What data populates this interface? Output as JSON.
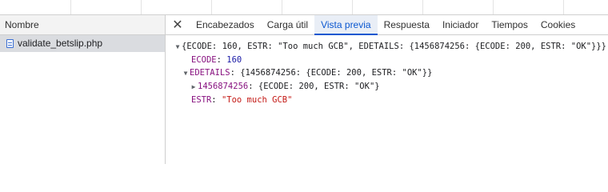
{
  "left_panel": {
    "header": "Nombre",
    "file": "validate_betslip.php"
  },
  "tabs": {
    "close_symbol": "✕",
    "items": [
      "Encabezados",
      "Carga útil",
      "Vista previa",
      "Respuesta",
      "Iniciador",
      "Tiempos",
      "Cookies"
    ],
    "active_index": 2
  },
  "preview": {
    "root_summary": "{ECODE: 160, ESTR: \"Too much GCB\", EDETAILS: {1456874256: {ECODE: 200, ESTR: \"OK\"}}}",
    "ecode_key": "ECODE",
    "ecode_value": "160",
    "edetails_key": "EDETAILS",
    "edetails_summary": "{1456874256: {ECODE: 200, ESTR: \"OK\"}}",
    "sub_key": "1456874256",
    "sub_summary": "{ECODE: 200, ESTR: \"OK\"}",
    "estr_key": "ESTR",
    "estr_value": "\"Too much GCB\""
  },
  "colors": {
    "key": "#881280",
    "number": "#1a1aa6",
    "string": "#c41a16",
    "active_tab": "#0b57d0"
  }
}
